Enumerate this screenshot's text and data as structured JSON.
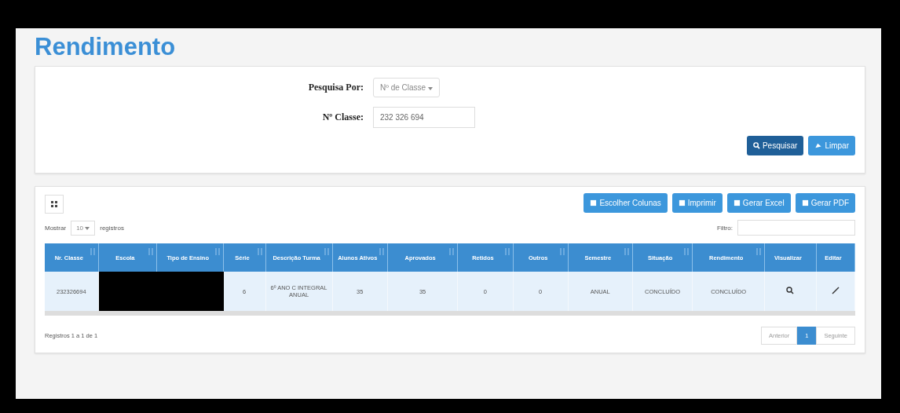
{
  "title": "Rendimento",
  "search": {
    "fields": [
      {
        "kind": "select",
        "label": "Pesquisa Por:",
        "value": "Nº de Classe"
      },
      {
        "kind": "input",
        "label": "Nº Classe:",
        "value": "232 326 694"
      }
    ],
    "buttons": [
      {
        "label": "Pesquisar",
        "kind": "primary"
      },
      {
        "label": "Limpar",
        "kind": "secondary"
      }
    ]
  },
  "results": {
    "actions": [
      "Escolher Colunas",
      "Imprimir",
      "Gerar Excel",
      "Gerar PDF"
    ],
    "show": {
      "before": "Mostrar",
      "value": "10",
      "after": "registros"
    },
    "filter": {
      "label": "Filtro:"
    },
    "columns": [
      {
        "label": "Nr. Classe",
        "sortable": true
      },
      {
        "label": "Escola",
        "sortable": true
      },
      {
        "label": "Tipo de Ensino",
        "sortable": true
      },
      {
        "label": "Série",
        "sortable": true
      },
      {
        "label": "Descrição Turma",
        "sortable": true
      },
      {
        "label": "Alunos Ativos",
        "sortable": true
      },
      {
        "label": "Aprovados",
        "sortable": true
      },
      {
        "label": "Retidos",
        "sortable": true
      },
      {
        "label": "Outros",
        "sortable": true
      },
      {
        "label": "Semestre",
        "sortable": true
      },
      {
        "label": "Situação",
        "sortable": true
      },
      {
        "label": "Rendimento",
        "sortable": true
      },
      {
        "label": "Visualizar",
        "sortable": false
      },
      {
        "label": "Editar",
        "sortable": false
      }
    ],
    "rows": [
      {
        "cells": [
          "232326694",
          "",
          "",
          "6",
          "6º ANO C INTEGRAL ANUAL",
          "35",
          "35",
          "0",
          "0",
          "ANUAL",
          "CONCLUÍDO",
          "CONCLUÍDO"
        ],
        "redacted": true
      }
    ],
    "info": "Registros 1 a 1 de 1",
    "pagination": [
      {
        "label": "Anterior",
        "selected": false
      },
      {
        "label": "1",
        "selected": true
      },
      {
        "label": "Seguinte",
        "selected": false
      }
    ]
  }
}
